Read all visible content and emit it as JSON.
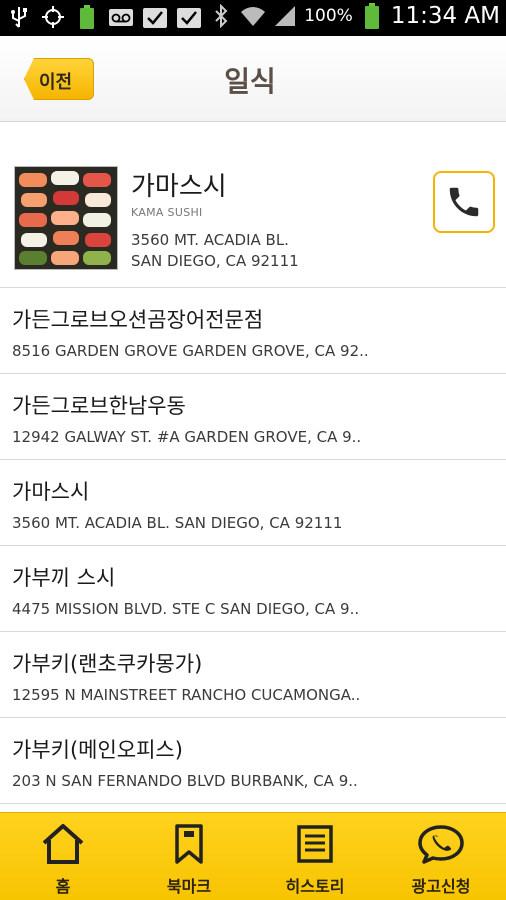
{
  "status_bar": {
    "battery_percent": "100%",
    "time": "11:34 AM",
    "icons": [
      "usb-icon",
      "gps-icon",
      "battery-small-icon",
      "voicemail-icon",
      "check-icon",
      "check-icon",
      "bluetooth-icon",
      "wifi-icon",
      "signal-icon",
      "battery-icon"
    ]
  },
  "header": {
    "back_label": "이전",
    "title": "일식"
  },
  "featured": {
    "name": "가마스시",
    "subtitle": "KAMA SUSHI",
    "address_line1": "3560 MT. ACADIA BL.",
    "address_line2": "SAN DIEGO, CA 92111",
    "call_icon": "phone-icon"
  },
  "list": [
    {
      "name": "가든그로브오션곰장어전문점",
      "address": "8516 GARDEN GROVE GARDEN GROVE, CA 92.."
    },
    {
      "name": "가든그로브한남우동",
      "address": "12942 GALWAY ST. #A GARDEN GROVE, CA 9.."
    },
    {
      "name": "가마스시",
      "address": "3560 MT. ACADIA BL. SAN DIEGO, CA 92111"
    },
    {
      "name": "가부끼 스시",
      "address": "4475 MISSION BLVD. STE C SAN DIEGO, CA 9.."
    },
    {
      "name": "가부키(랜초쿠카몽가)",
      "address": "12595 N MAINSTREET RANCHO CUCAMONGA.."
    },
    {
      "name": "가부키(메인오피스)",
      "address": "203 N SAN FERNANDO BLVD BURBANK, CA 9.."
    }
  ],
  "nav": {
    "home": "홈",
    "bookmark": "북마크",
    "history": "히스토리",
    "ad_request": "광고신청"
  },
  "colors": {
    "accent": "#f7c400",
    "title": "#5b4f46",
    "call_border": "#f5b400"
  }
}
